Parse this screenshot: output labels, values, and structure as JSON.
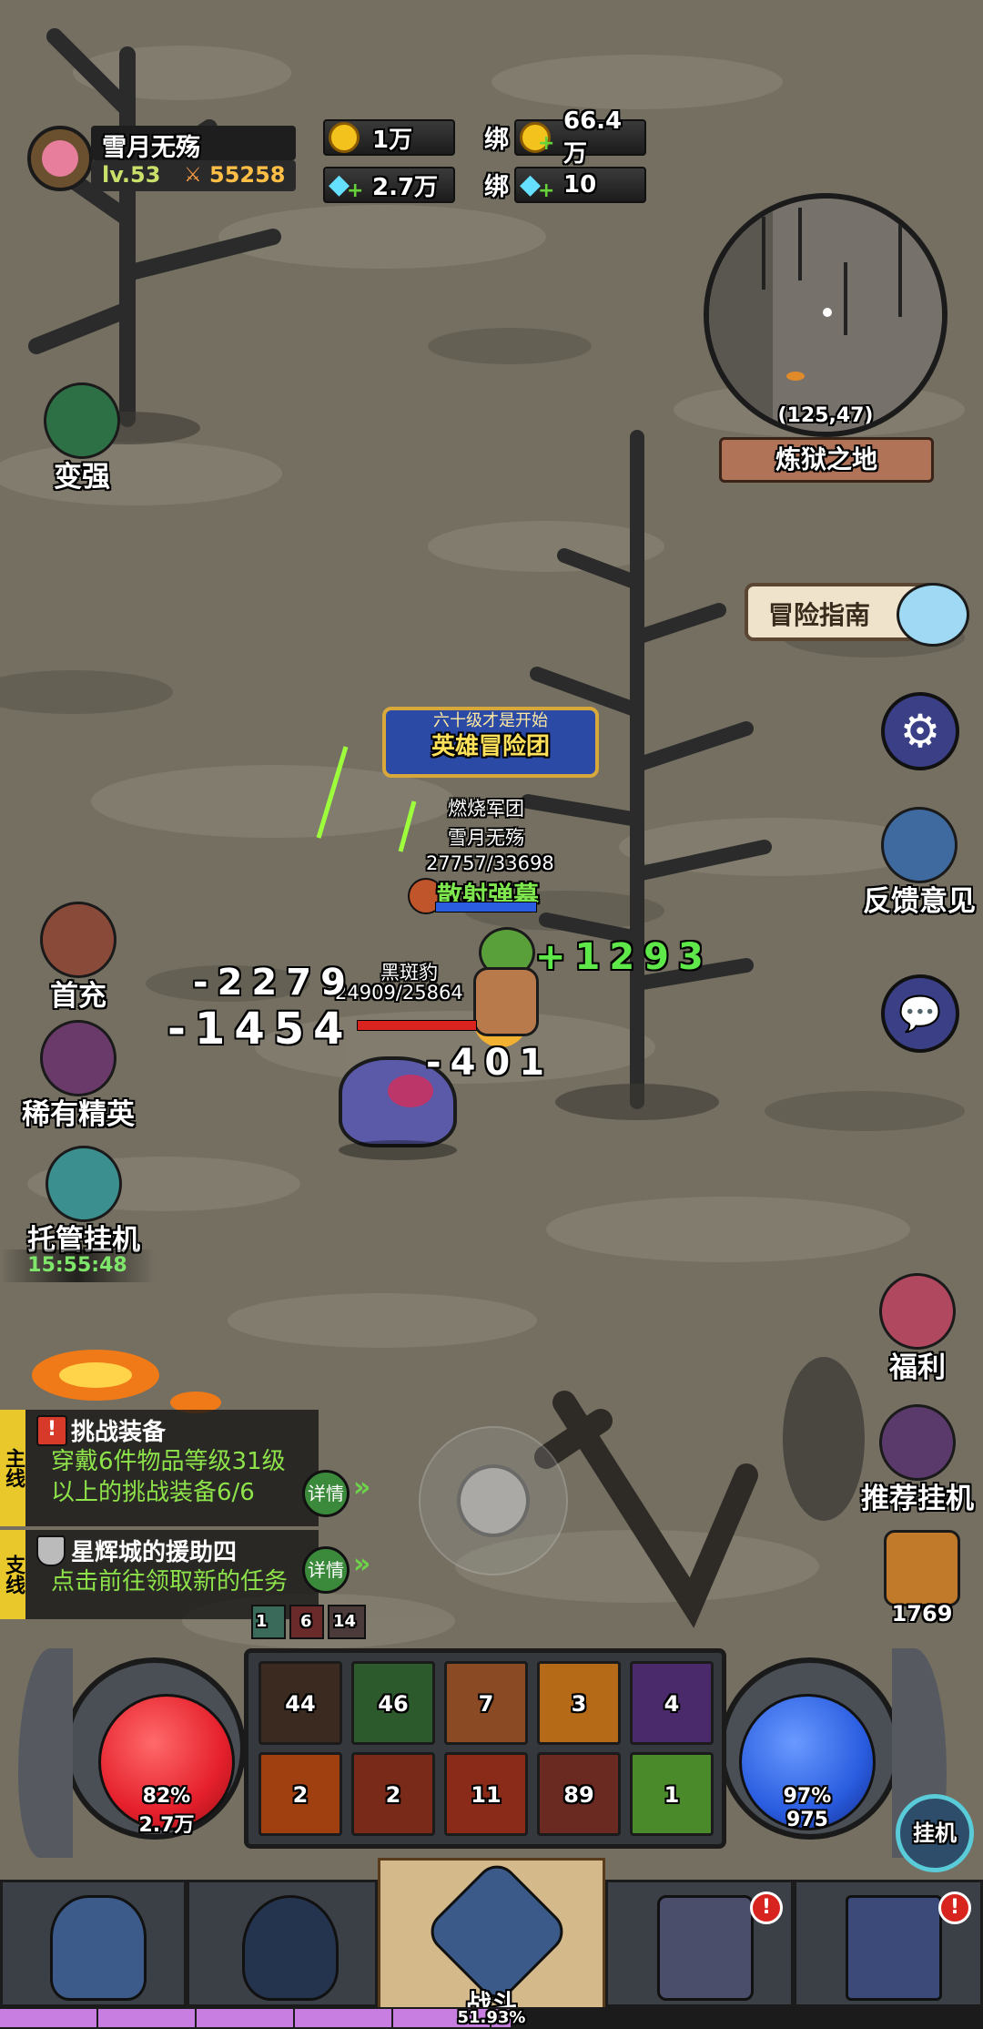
{
  "player": {
    "name": "雪月无殇",
    "level": "lv.53",
    "power": "55258"
  },
  "resources": {
    "gold": "1万",
    "diamond": "2.7万",
    "bound_label": "绑",
    "bound_gold": "66.4万",
    "bound_diamond": "10"
  },
  "minimap": {
    "coords": "(125,47)",
    "location": "炼狱之地"
  },
  "left_buttons": {
    "strengthen": "变强",
    "first_recharge": "首充",
    "rare_elite": "稀有精英",
    "auto_idle": "托管挂机",
    "timer": "15:55:48"
  },
  "right_buttons": {
    "guide": "冒险指南",
    "feedback": "反馈意见",
    "welfare": "福利",
    "recommend": "推荐挂机",
    "gift_count": "1769"
  },
  "battle": {
    "banner_line1": "六十级才是开始",
    "banner_line2": "英雄冒险团",
    "guild": "燃烧军团",
    "hero_name": "雪月无殇",
    "hero_hp": "27757/33698",
    "skill": "散射弹幕",
    "enemy_name": "黑斑豹",
    "enemy_hp": "24909/25864",
    "dmg1": "-2279",
    "dmg2": "-1454",
    "dmg3": "-401",
    "heal": "+1293"
  },
  "quests": {
    "main_tag": "主线",
    "main_title": "挑战装备",
    "main_body": "穿戴6件物品等级31级以上的挑战装备6/6",
    "side_tag": "支线",
    "side_title": "星辉城的援助四",
    "side_body": "点击前往领取新的任务",
    "detail_label": "详情"
  },
  "buffs": [
    "1",
    "6",
    "14"
  ],
  "skills_top": [
    "44",
    "46",
    "7",
    "3",
    "4"
  ],
  "skills_bottom": [
    "2",
    "2",
    "11",
    "89",
    "1"
  ],
  "hp_orb": {
    "percent": "82%",
    "value": "2.7万"
  },
  "mp_orb": {
    "percent": "97%",
    "value": "975"
  },
  "idle_button": "挂机",
  "nav": {
    "battle": "战斗",
    "badge": "!"
  },
  "exp_bar": {
    "percent_label": "51.93%",
    "fraction": 0.5193
  },
  "colors": {
    "hp": "#e5202c",
    "mp": "#2a5de0",
    "exp": "#c77ee0"
  }
}
